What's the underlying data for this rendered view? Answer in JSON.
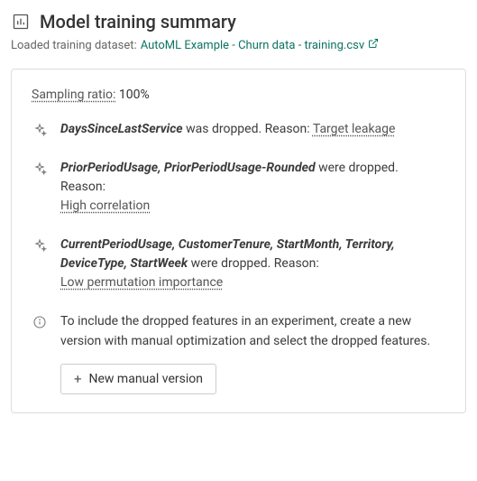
{
  "header": {
    "title": "Model training summary",
    "dataset_label": "Loaded training dataset:",
    "dataset_link": "AutoML Example - Churn data - training.csv"
  },
  "sampling": {
    "label": "Sampling ratio:",
    "value": "100%"
  },
  "drops": [
    {
      "features": "DaysSinceLastService",
      "verb": "was dropped. Reason:",
      "reason": "Target leakage"
    },
    {
      "features": "PriorPeriodUsage, PriorPeriodUsage-Rounded",
      "verb": "were dropped. Reason:",
      "reason": "High correlation"
    },
    {
      "features": "CurrentPeriodUsage, CustomerTenure, StartMonth, Territory, DeviceType, StartWeek",
      "verb": "were dropped. Reason:",
      "reason": "Low permutation importance"
    }
  ],
  "info": {
    "text": "To include the dropped features in an experiment, create a new version with manual optimization and select the dropped features.",
    "button_label": "New manual version"
  }
}
